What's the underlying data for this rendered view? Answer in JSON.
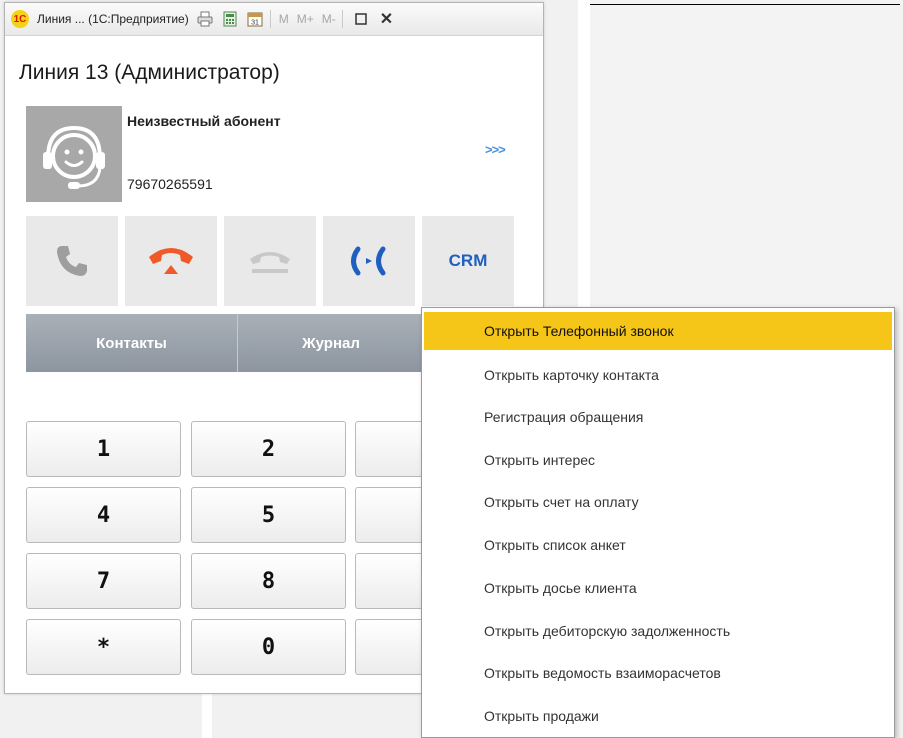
{
  "window": {
    "title": "Линия ... (1С:Предприятие)",
    "logo": "1С",
    "toolbar": [
      "print-icon",
      "calculator-icon",
      "calendar-icon"
    ],
    "memory_buttons": [
      "M",
      "M+",
      "M-"
    ],
    "calendar_day": "31"
  },
  "line_title": "Линия 13 (Администратор)",
  "caller": {
    "name": "Неизвестный абонент",
    "phone": "79670265591",
    "more": ">>>"
  },
  "actions": [
    {
      "icon": "phone-answer-icon",
      "color": "#9e9e9e"
    },
    {
      "icon": "phone-hangup-icon",
      "color": "#f05a28"
    },
    {
      "icon": "phone-hold-icon",
      "color": "#c8c8c8"
    },
    {
      "icon": "phone-transfer-icon",
      "color": "#1f5fc0"
    },
    {
      "label": "CRM",
      "color": "#1f5fc0"
    }
  ],
  "tabs": [
    "Контакты",
    "Журнал"
  ],
  "keypad": [
    "1",
    "2",
    "4",
    "5",
    "7",
    "8",
    "*",
    "0"
  ],
  "context_menu": [
    "Открыть Телефонный звонок",
    "Открыть карточку контакта",
    "Регистрация обращения",
    "Открыть интерес",
    "Открыть счет на оплату",
    "Открыть список анкет",
    "Открыть досье клиента",
    "Открыть дебиторскую задолженность",
    "Открыть ведомость взаиморасчетов",
    "Открыть продажи"
  ],
  "colors": {
    "menu_highlight": "#f5c518",
    "tab_bg": "#97a0aa",
    "crm_blue": "#1f5fc0",
    "hangup_orange": "#f05a28"
  }
}
